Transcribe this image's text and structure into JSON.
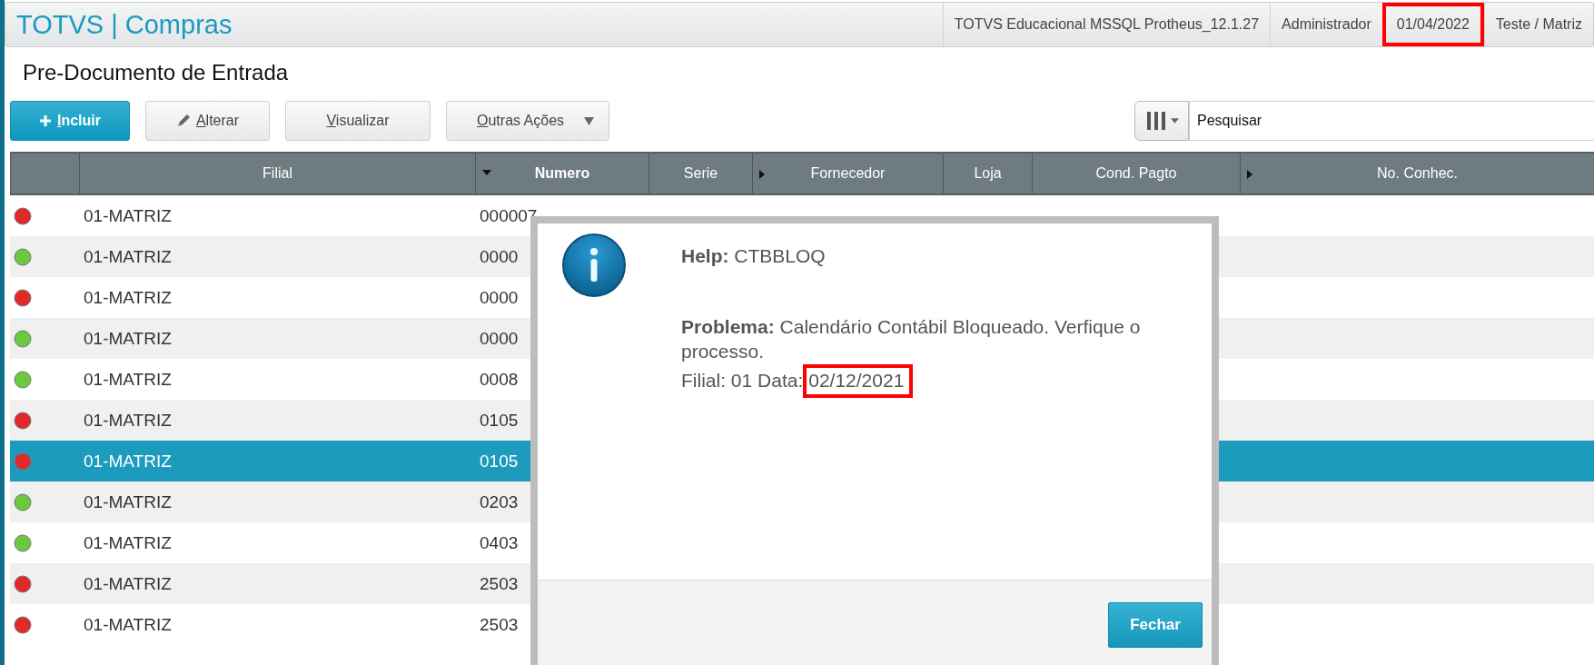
{
  "app_bar": {
    "title": "TOTVS | Compras",
    "items": [
      {
        "text": "TOTVS Educacional MSSQL Protheus_12.1.27",
        "highlighted": false
      },
      {
        "text": "Administrador",
        "highlighted": false
      },
      {
        "text": "01/04/2022",
        "highlighted": true
      },
      {
        "text": "Teste / Matriz",
        "highlighted": false
      }
    ]
  },
  "page_title": "Pre-Documento de Entrada",
  "toolbar": {
    "buttons": [
      {
        "label": "Incluir",
        "kind": "primary"
      },
      {
        "label": "Alterar",
        "kind": "edit"
      },
      {
        "label": "Visualizar",
        "kind": "plain"
      },
      {
        "label": "Outras Ações",
        "kind": "menu"
      }
    ],
    "search": {
      "placeholder": "Pesquisar"
    }
  },
  "table": {
    "columns": [
      {
        "sorted": false,
        "expandable": false
      },
      {
        "label": "Filial",
        "sorted": false,
        "expandable": false
      },
      {
        "label": "Numero",
        "sorted": true,
        "expandable": false
      },
      {
        "label": "Serie",
        "sorted": false,
        "expandable": false
      },
      {
        "label": "Fornecedor",
        "sorted": false,
        "expandable": true
      },
      {
        "label": "Loja",
        "sorted": false,
        "expandable": false
      },
      {
        "label": "Cond. Pagto",
        "sorted": false,
        "expandable": false
      },
      {
        "label": "No. Conhec.",
        "sorted": false,
        "expandable": true
      }
    ],
    "rows": [
      {
        "color": "#e02a2a",
        "selected": false,
        "cells": [
          "01-MATRIZ",
          "000007"
        ]
      },
      {
        "color": "#6cc83c",
        "selected": false,
        "cells": [
          "01-MATRIZ",
          "0000"
        ]
      },
      {
        "color": "#e02a2a",
        "selected": false,
        "cells": [
          "01-MATRIZ",
          "0000"
        ]
      },
      {
        "color": "#6cc83c",
        "selected": false,
        "cells": [
          "01-MATRIZ",
          "0000"
        ]
      },
      {
        "color": "#6cc83c",
        "selected": false,
        "cells": [
          "01-MATRIZ",
          "0008"
        ]
      },
      {
        "color": "#e02a2a",
        "selected": false,
        "cells": [
          "01-MATRIZ",
          "0105"
        ]
      },
      {
        "color": "#e02a2a",
        "selected": true,
        "cells": [
          "01-MATRIZ",
          "0105"
        ]
      },
      {
        "color": "#6cc83c",
        "selected": false,
        "cells": [
          "01-MATRIZ",
          "0203"
        ]
      },
      {
        "color": "#6cc83c",
        "selected": false,
        "cells": [
          "01-MATRIZ",
          "0403"
        ]
      },
      {
        "color": "#e02a2a",
        "selected": false,
        "cells": [
          "01-MATRIZ",
          "2503"
        ]
      },
      {
        "color": "#e02a2a",
        "selected": false,
        "cells": [
          "01-MATRIZ",
          "2503"
        ]
      }
    ]
  },
  "dialog": {
    "help": "**Help:** CTBBLOQ",
    "problem": "**Problema:** Calendário Contábil Bloqueado. Verfique o processo.",
    "detail": "Filial: 01 Data:",
    "date": {
      "text": "02/12/2021",
      "highlighted": true
    },
    "button": "Fechar"
  }
}
